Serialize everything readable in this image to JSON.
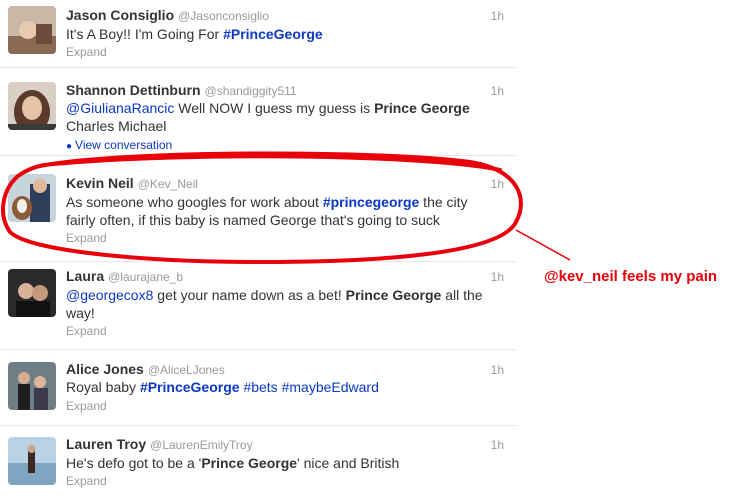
{
  "tweets": [
    {
      "name": "Jason Consiglio",
      "handle": "@Jasonconsiglio",
      "time": "1h",
      "text": {
        "a": "It's A Boy!! I'm Going For ",
        "b": "#PrinceGeorge"
      },
      "expand": "Expand"
    },
    {
      "name": "Shannon Dettinburn",
      "handle": "@shandiggity511",
      "time": "1h",
      "text": {
        "mention": "@GiulianaRancic",
        "a": " Well NOW I guess my guess is ",
        "b": "Prince George",
        "c": "Charles Michael"
      },
      "conversation": "View conversation",
      "expand": ""
    },
    {
      "name": "Kevin Neil",
      "handle": "@Kev_Neil",
      "time": "1h",
      "text": {
        "a": "As someone who googles for work about ",
        "b": "#princegeorge",
        "c": " the city",
        "d": "fairly often, if this baby is named George that's going to suck"
      },
      "expand": "Expand"
    },
    {
      "name": "Laura",
      "handle": "@laurajane_b",
      "time": "1h",
      "text": {
        "mention": "@georgecox8",
        "a": " get your name down as a bet! ",
        "b": "Prince George",
        "c": " all the",
        "d": "way!"
      },
      "expand": "Expand"
    },
    {
      "name": "Alice Jones",
      "handle": "@AliceLJones",
      "time": "1h",
      "text": {
        "a": "Royal baby ",
        "b": "#PrinceGeorge",
        "c": "#bets",
        "d": "#maybeEdward"
      },
      "expand": "Expand"
    },
    {
      "name": "Lauren Troy",
      "handle": "@LaurenEmilyTroy",
      "time": "1h",
      "text": {
        "a": "He's defo got to be a '",
        "b": "Prince George",
        "c": "' nice and British"
      },
      "expand": "Expand"
    }
  ],
  "annotation": "@kev_neil feels my pain",
  "colors": {
    "link": "#0b38c4",
    "annotation": "#e8000a",
    "meta": "#999999"
  }
}
